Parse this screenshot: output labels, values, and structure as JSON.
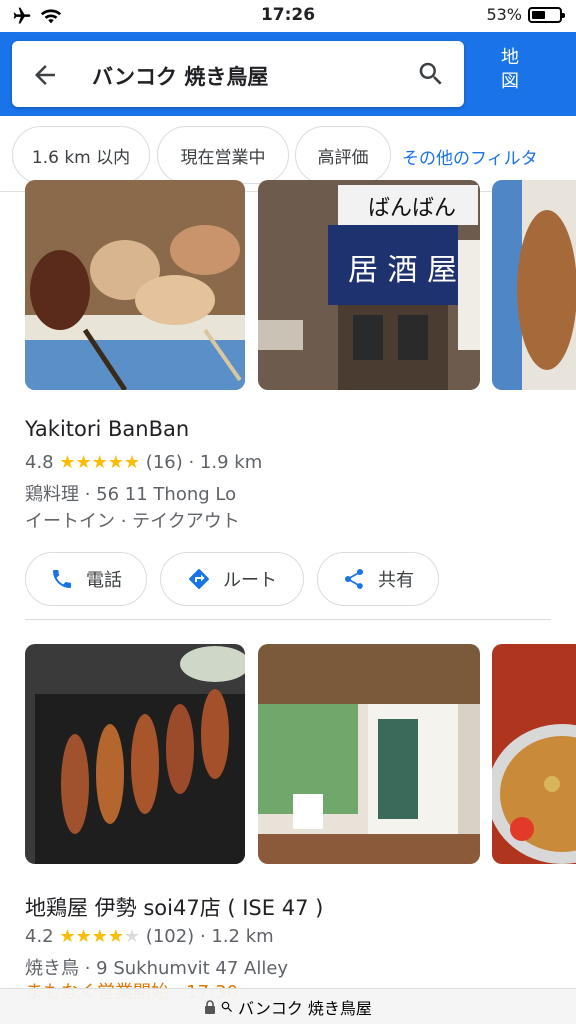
{
  "status_bar": {
    "time": "17:26",
    "battery": "53%",
    "battery_level": 0.53
  },
  "search": {
    "query": "バンコク 焼き鳥屋",
    "map_label_line1": "地",
    "map_label_line2": "図"
  },
  "filters": [
    {
      "label": "1.6 km 以内"
    },
    {
      "label": "現在営業中"
    },
    {
      "label": "高評価"
    }
  ],
  "filters_more": "その他のフィルタ",
  "listings": [
    {
      "name": "Yakitori BanBan",
      "rating": "4.8",
      "stars": 5,
      "reviews": "(16)",
      "distance": "· 1.9 km",
      "category_address": "鶏料理 · 56 11 Thong Lo",
      "services": "イートイン · テイクアウト",
      "sign_text": "居 酒 屋",
      "sign_top": "ばんばん"
    },
    {
      "name": "地鶏屋 伊勢 soi47店 ( ISE 47 )",
      "rating": "4.2",
      "stars": 4,
      "reviews": "(102)",
      "distance": "· 1.2 km",
      "category_address": "焼き鳥 · 9 Sukhumvit 47 Alley",
      "status": "まもなく営業開始 · 17:30"
    }
  ],
  "actions": {
    "call": "電話",
    "route": "ルート",
    "share": "共有"
  },
  "bottom_bar": {
    "url": "バンコク 焼き鳥屋"
  },
  "colors": {
    "brand": "#1a73e8",
    "star": "#fbbc04",
    "warning": "#e37400"
  }
}
